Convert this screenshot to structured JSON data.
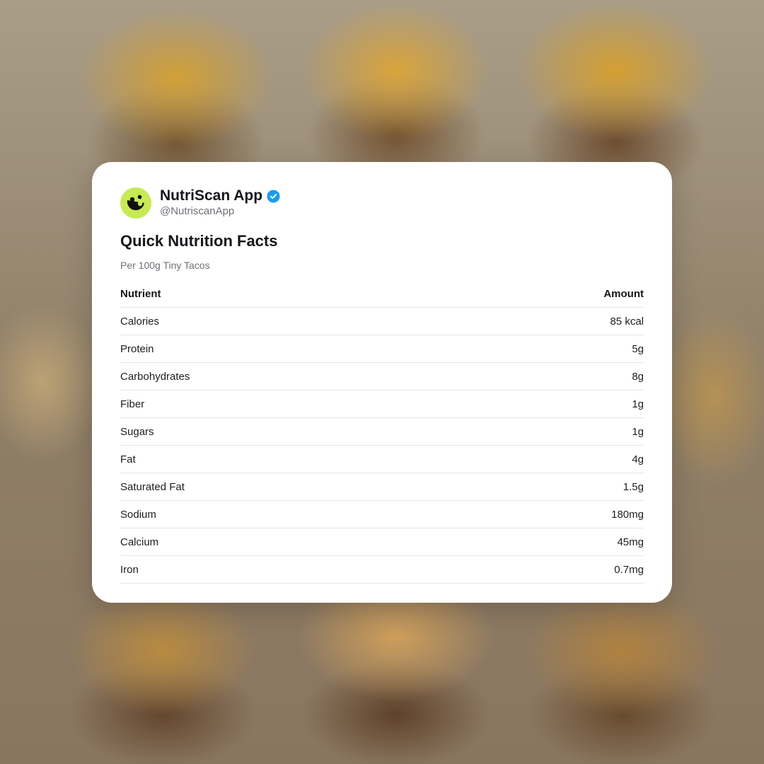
{
  "account": {
    "name": "NutriScan App",
    "handle": "@NutriscanApp",
    "verified": true,
    "avatar_icon": "nutriscan-logo-icon",
    "avatar_color": "#c7ea55",
    "verified_color": "#1d9bf0"
  },
  "card": {
    "title": "Quick Nutrition Facts",
    "subtitle": "Per 100g Tiny Tacos"
  },
  "table": {
    "headers": [
      "Nutrient",
      "Amount"
    ],
    "rows": [
      {
        "nutrient": "Calories",
        "amount": "85 kcal"
      },
      {
        "nutrient": "Protein",
        "amount": "5g"
      },
      {
        "nutrient": "Carbohydrates",
        "amount": "8g"
      },
      {
        "nutrient": "Fiber",
        "amount": "1g"
      },
      {
        "nutrient": "Sugars",
        "amount": "1g"
      },
      {
        "nutrient": "Fat",
        "amount": "4g"
      },
      {
        "nutrient": "Saturated Fat",
        "amount": "1.5g"
      },
      {
        "nutrient": "Sodium",
        "amount": "180mg"
      },
      {
        "nutrient": "Calcium",
        "amount": "45mg"
      },
      {
        "nutrient": "Iron",
        "amount": "0.7mg"
      }
    ]
  }
}
